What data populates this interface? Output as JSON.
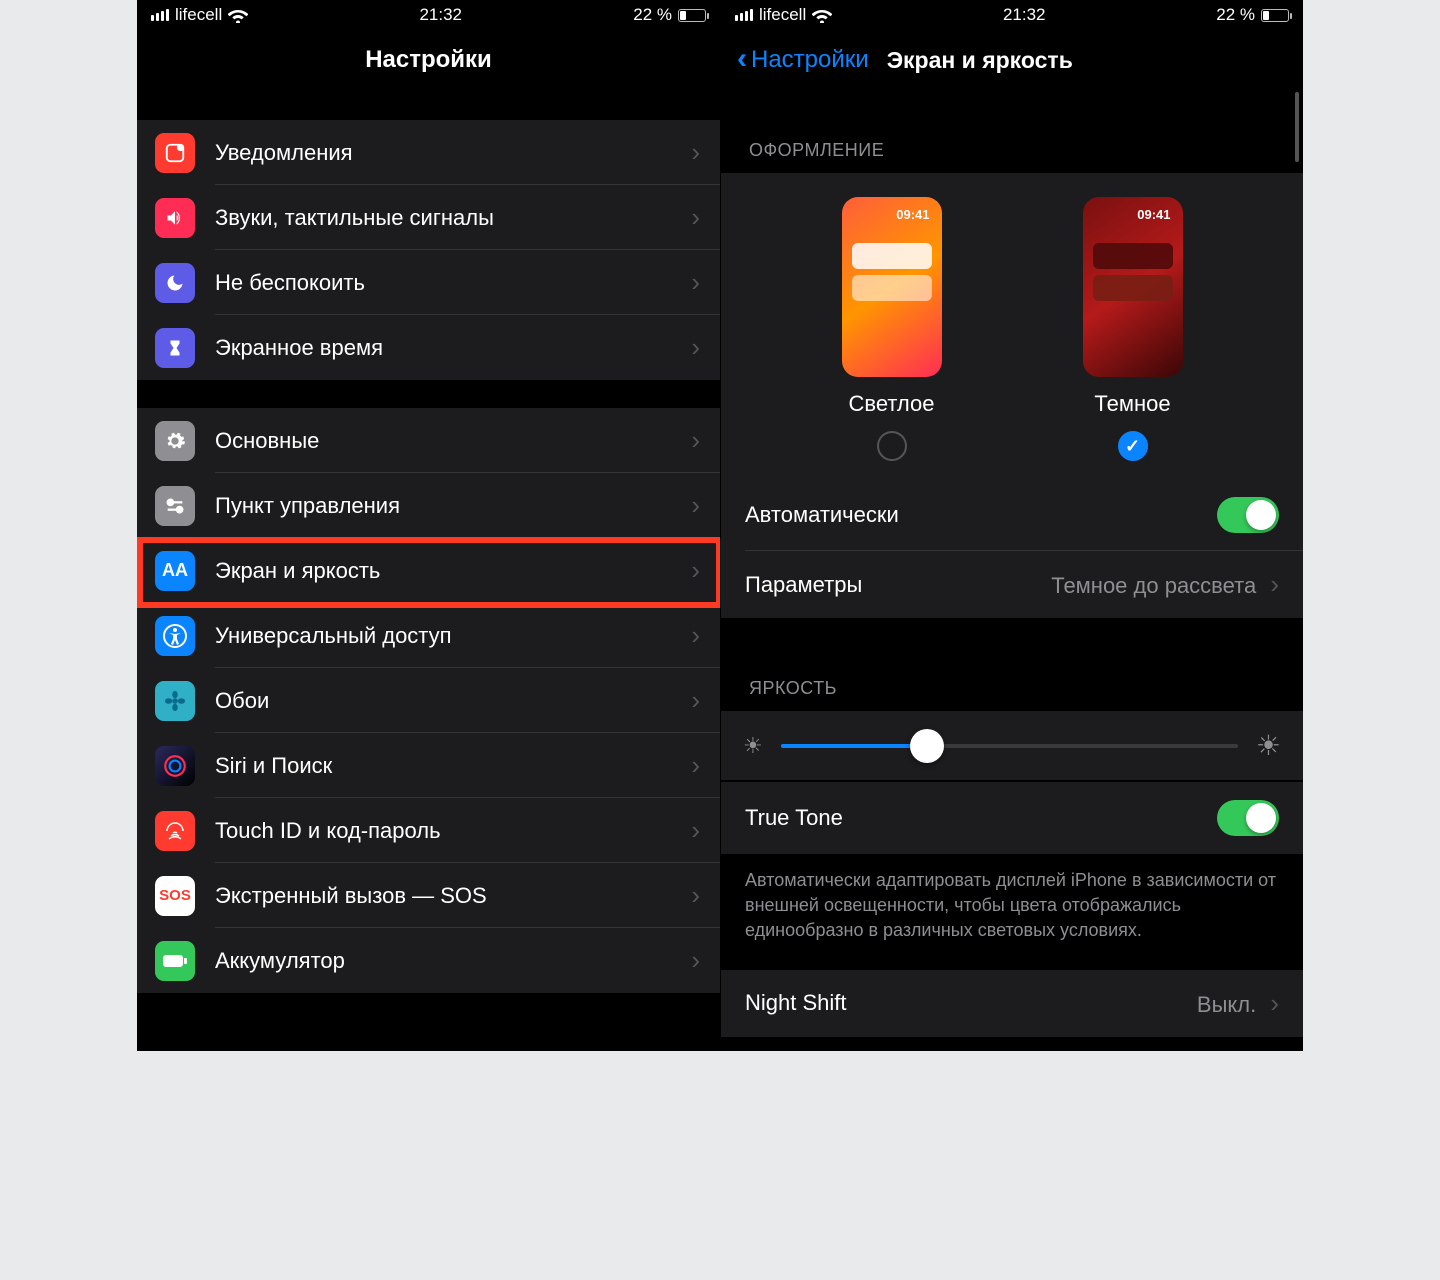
{
  "status": {
    "carrier": "lifecell",
    "time": "21:32",
    "battery_text": "22 %"
  },
  "left": {
    "title": "Настройки",
    "rows": [
      {
        "id": "notifications",
        "label": "Уведомления",
        "bg": "#ff3b30"
      },
      {
        "id": "sounds",
        "label": "Звуки, тактильные сигналы",
        "bg": "#ff3b30"
      },
      {
        "id": "dnd",
        "label": "Не беспокоить",
        "bg": "#5e5ce6"
      },
      {
        "id": "screentime",
        "label": "Экранное время",
        "bg": "#5e5ce6"
      },
      {
        "id": "general",
        "label": "Основные",
        "bg": "#8e8e93"
      },
      {
        "id": "controlcenter",
        "label": "Пункт управления",
        "bg": "#8e8e93"
      },
      {
        "id": "display",
        "label": "Экран и яркость",
        "bg": "#0a84ff"
      },
      {
        "id": "accessibility",
        "label": "Универсальный доступ",
        "bg": "#0a84ff"
      },
      {
        "id": "wallpaper",
        "label": "Обои",
        "bg": "#30b0c7"
      },
      {
        "id": "siri",
        "label": "Siri и Поиск",
        "bg": "#1c1c1e"
      },
      {
        "id": "touchid",
        "label": "Touch ID и код-пароль",
        "bg": "#ff3b30"
      },
      {
        "id": "sos",
        "label": "Экстренный вызов — SOS",
        "bg": "#ffffff"
      },
      {
        "id": "battery",
        "label": "Аккумулятор",
        "bg": "#34c759"
      }
    ]
  },
  "right": {
    "back": "Настройки",
    "title": "Экран и яркость",
    "section_appearance": "ОФОРМЛЕНИЕ",
    "preview_time": "09:41",
    "option_light": "Светлое",
    "option_dark": "Темное",
    "automatic_label": "Автоматически",
    "parameters_label": "Параметры",
    "parameters_value": "Темное до рассвета",
    "section_brightness": "ЯРКОСТЬ",
    "truetone_label": "True Tone",
    "truetone_footer": "Автоматически адаптировать дисплей iPhone в зависимости от внешней освещенности, чтобы цвета отображались единообразно в различных световых условиях.",
    "nightshift_label": "Night Shift",
    "nightshift_value": "Выкл."
  },
  "icons": {
    "notifications": "square-dot",
    "sounds": "speaker",
    "dnd": "moon",
    "screentime": "hourglass",
    "general": "gear",
    "controlcenter": "switches",
    "display": "AA",
    "accessibility": "person-circle",
    "wallpaper": "flower",
    "siri": "siri",
    "touchid": "fingerprint",
    "sos": "SOS",
    "battery": "battery"
  }
}
